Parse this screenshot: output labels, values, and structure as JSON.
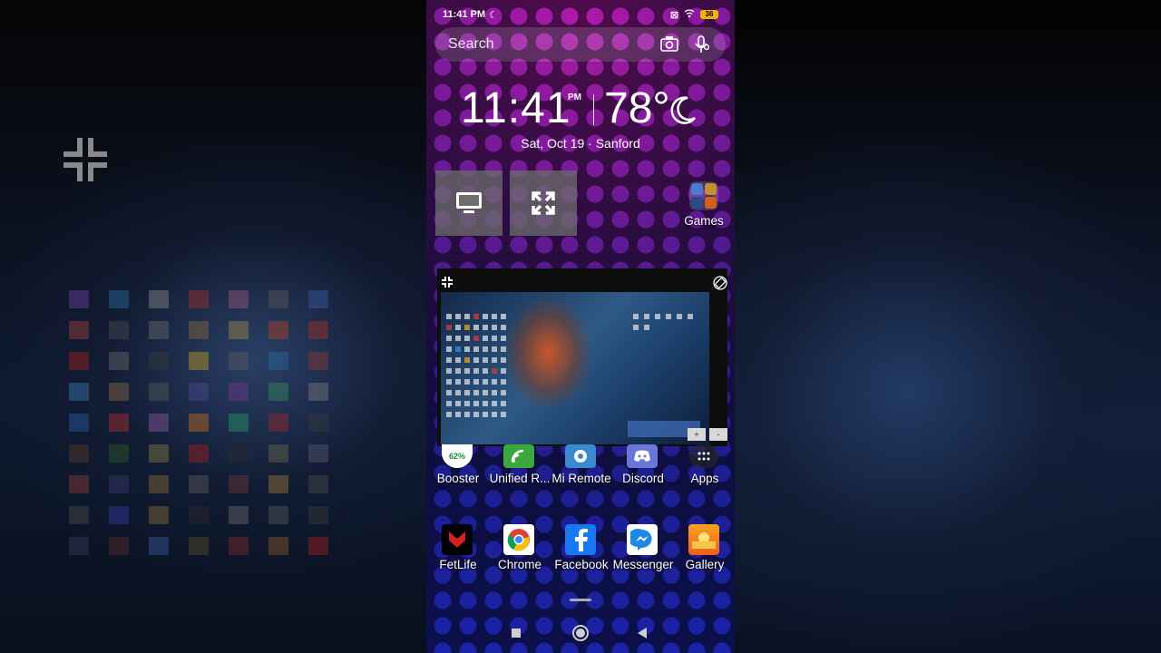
{
  "status": {
    "time": "11:41 PM",
    "battery": "36"
  },
  "search": {
    "placeholder": "Search"
  },
  "clock": {
    "time": "11:41",
    "ampm": "PM",
    "temp": "78°"
  },
  "date_location": "Sat, Oct 19 · Sanford",
  "folder": {
    "label": "Games"
  },
  "row1_apps": [
    {
      "label": "Booster",
      "badge": "62%"
    },
    {
      "label": "Unified R..."
    },
    {
      "label": "Mi Remote"
    },
    {
      "label": "Discord"
    },
    {
      "label": "Apps"
    }
  ],
  "row2_apps": [
    {
      "label": "FetLife"
    },
    {
      "label": "Chrome"
    },
    {
      "label": "Facebook"
    },
    {
      "label": "Messenger"
    },
    {
      "label": "Gallery"
    }
  ],
  "preview": {
    "zoom_in": "+",
    "zoom_out": "-"
  },
  "colors": {
    "accent_magenta": "#b01aa8",
    "accent_blue": "#1a23a8"
  }
}
